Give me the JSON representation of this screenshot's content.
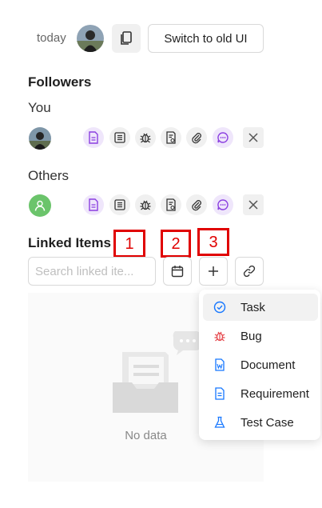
{
  "header": {
    "date_label": "today",
    "switch_button_label": "Switch to old UI"
  },
  "followers": {
    "title": "Followers",
    "you_label": "You",
    "others_label": "Others"
  },
  "linked_items": {
    "title": "Linked Items",
    "search_placeholder": "Search linked ite...",
    "empty_text": "No data"
  },
  "annotations": [
    "1",
    "2",
    "3"
  ],
  "add_menu": {
    "items": [
      {
        "label": "Task",
        "icon": "task-check-icon",
        "color": "#1677ff"
      },
      {
        "label": "Bug",
        "icon": "bug-icon",
        "color": "#e5484d"
      },
      {
        "label": "Document",
        "icon": "word-document-icon",
        "color": "#1677ff"
      },
      {
        "label": "Requirement",
        "icon": "requirement-doc-icon",
        "color": "#1677ff"
      },
      {
        "label": "Test Case",
        "icon": "flask-icon",
        "color": "#1677ff"
      }
    ]
  },
  "colors": {
    "accent_purple": "#8b3fe0",
    "annotation_red": "#e00000",
    "user_green": "#6bc46b"
  }
}
